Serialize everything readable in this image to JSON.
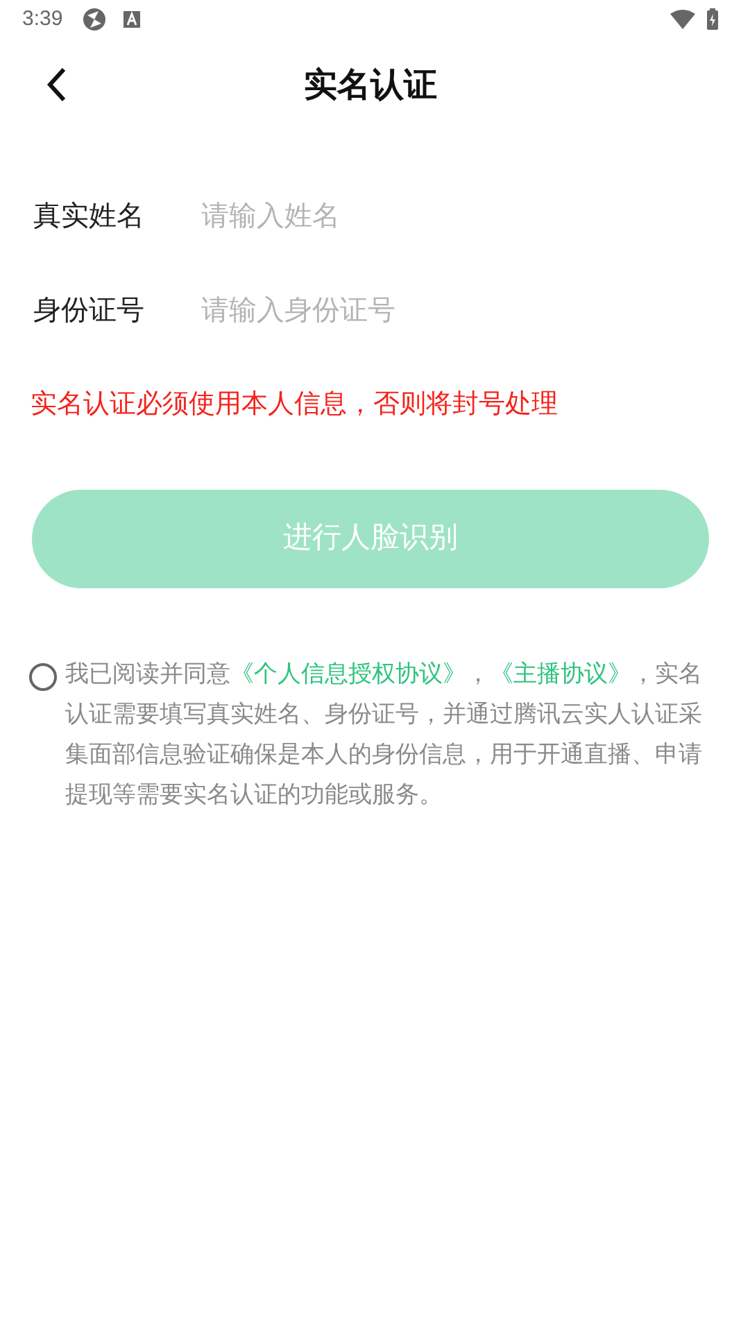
{
  "status_bar": {
    "time": "3:39"
  },
  "header": {
    "title": "实名认证"
  },
  "fields": [
    {
      "label": "真实姓名",
      "placeholder": "请输入姓名"
    },
    {
      "label": "身份证号",
      "placeholder": "请输入身份证号"
    }
  ],
  "warning": "实名认证必须使用本人信息，否则将封号处理",
  "submit_button": {
    "label": "进行人脸识别",
    "disabled": true
  },
  "agreement": {
    "checked": false,
    "segments": [
      {
        "kind": "text",
        "text": "我已阅读并同意"
      },
      {
        "kind": "link",
        "text": "《个人信息授权协议》"
      },
      {
        "kind": "text",
        "text": "，"
      },
      {
        "kind": "link",
        "text": "《主播协议》"
      },
      {
        "kind": "text",
        "text": "，实名认证需要填写真实姓名、身份证号，并通过腾讯云实人认证采集面部信息验证确保是本人的身份信息，用于开通直播、申请提现等需要实名认证的功能或服务。"
      }
    ]
  }
}
